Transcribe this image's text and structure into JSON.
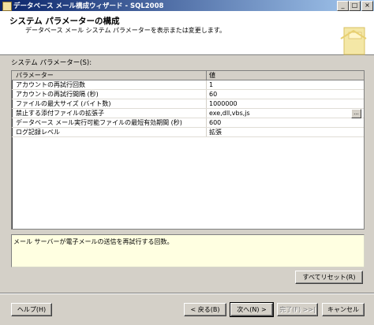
{
  "window": {
    "title": "データベース メール構成ウィザード - SQL2008"
  },
  "header": {
    "title": "システム パラメーターの構成",
    "subtitle": "データベース メール システム パラメーターを表示または変更します。"
  },
  "params_label": "システム パラメーター(S):",
  "grid": {
    "columns": [
      "パラメーター",
      "値"
    ],
    "rows": [
      {
        "name": "アカウントの再試行回数",
        "value": "1"
      },
      {
        "name": "アカウントの再試行間隔 (秒)",
        "value": "60"
      },
      {
        "name": "ファイルの最大サイズ (バイト数)",
        "value": "1000000"
      },
      {
        "name": "禁止する添付ファイルの拡張子",
        "value": "exe,dll,vbs,js"
      },
      {
        "name": "データベース メール実行可能ファイルの最短有効期間 (秒)",
        "value": "600"
      },
      {
        "name": "ログ記録レベル",
        "value": "拡張"
      }
    ],
    "ellipsis": "..."
  },
  "description": "メール サーバーが電子メールの送信を再試行する回数。",
  "buttons": {
    "reset_all": "すべてリセット(R)",
    "help": "ヘルプ(H)",
    "back": "< 戻る(B)",
    "next": "次へ(N) >",
    "finish": "完了(F) >>|",
    "cancel": "キャンセル"
  },
  "icons": {
    "app": "database-mail-icon",
    "logo": "wizard-logo-icon"
  }
}
